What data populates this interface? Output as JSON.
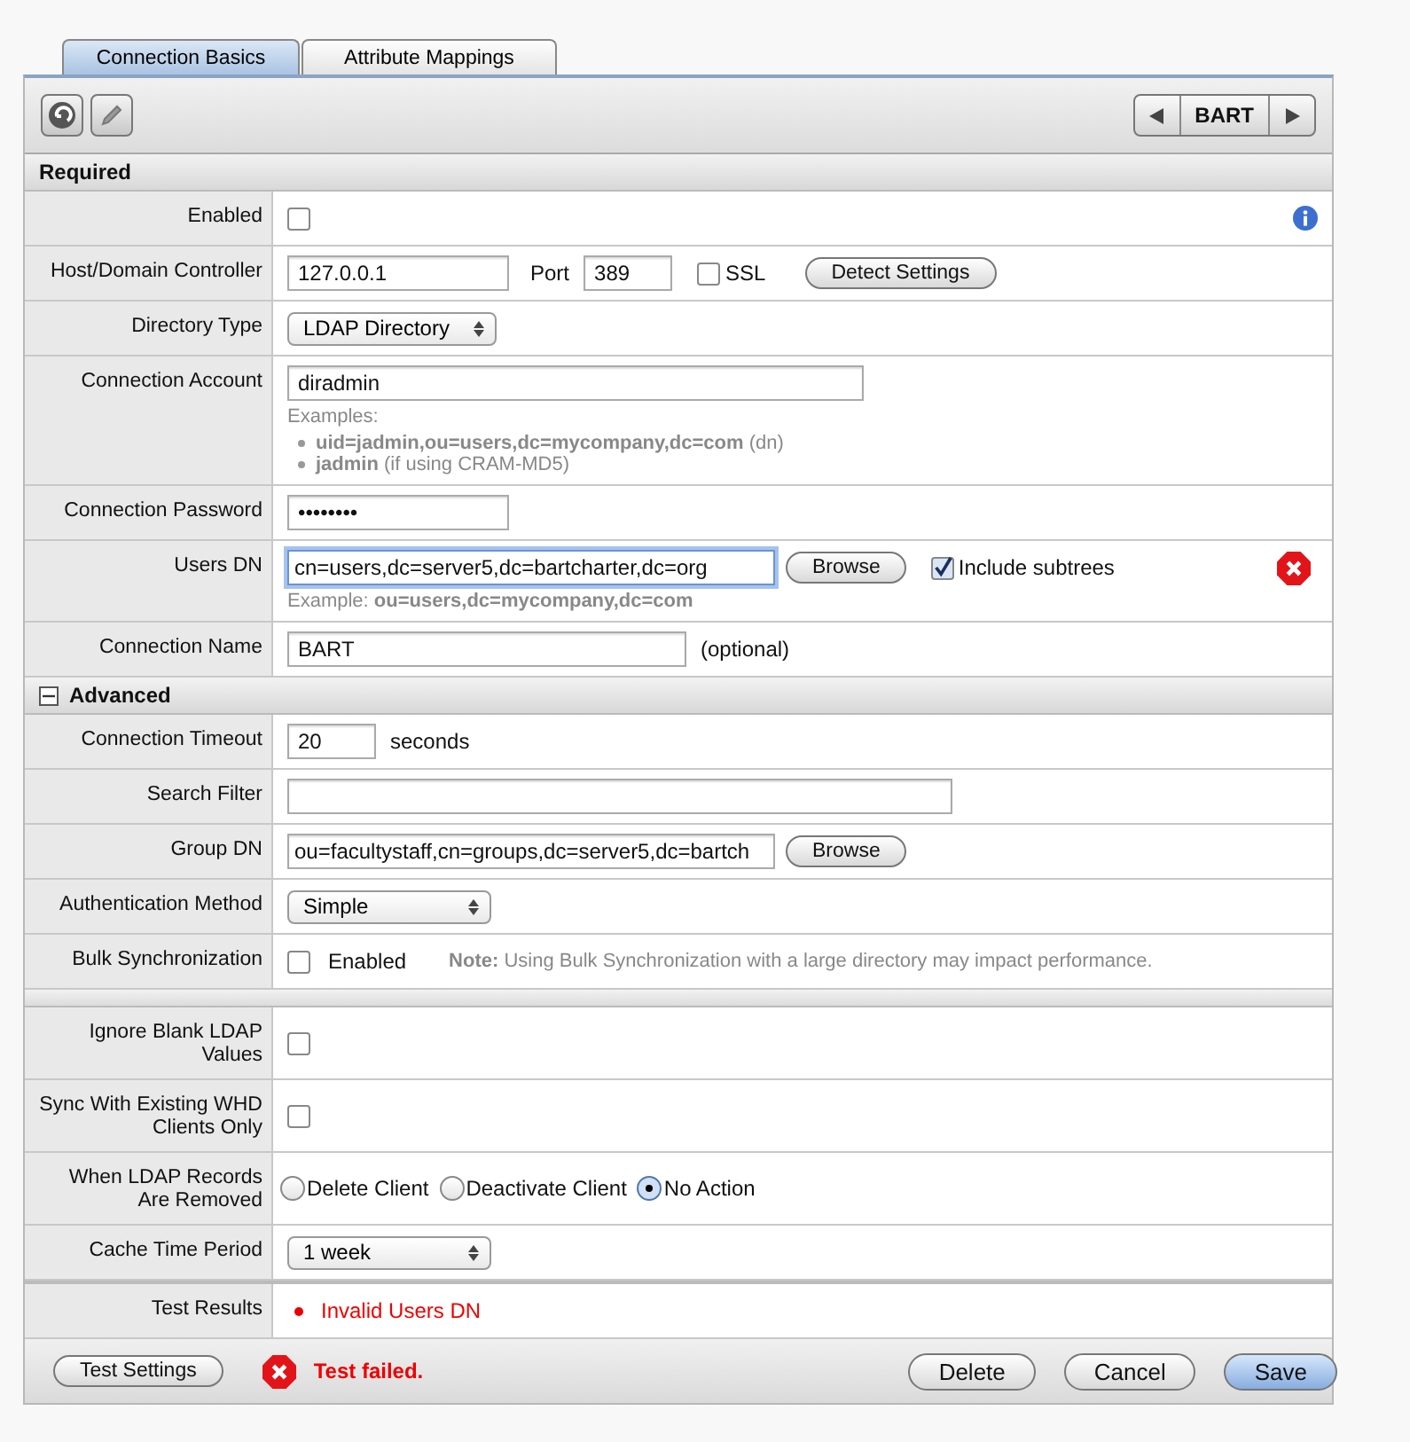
{
  "tabs": [
    {
      "label": "Connection Basics",
      "selected": true
    },
    {
      "label": "Attribute Mappings",
      "selected": false
    }
  ],
  "navigator": {
    "label": "BART"
  },
  "sections": [
    {
      "kind": "plain",
      "title": "Required",
      "rows": [
        {
          "kind": "checkbox",
          "label": "Enabled",
          "checked": false,
          "info": true
        },
        {
          "kind": "host",
          "label": "Host/Domain Controller",
          "value": "127.0.0.1",
          "port_label": "Port",
          "port": "389",
          "ssl_label": "SSL",
          "ssl": false,
          "button": "Detect Settings"
        },
        {
          "kind": "select",
          "label": "Directory Type",
          "value": "LDAP Directory"
        },
        {
          "kind": "examples",
          "label": "Connection Account",
          "value": "diradmin",
          "examples_title": "Examples:",
          "examples": [
            "**uid=jadmin,ou=users,dc=mycompany,dc=com** (dn)",
            "**jadmin** (if using CRAM-MD5)"
          ]
        },
        {
          "kind": "password",
          "label": "Connection Password",
          "value": "••••••••"
        },
        {
          "kind": "dn",
          "label": "Users DN",
          "value": "cn=users,dc=server5,dc=bartcharter,dc=org",
          "focused": true,
          "button": "Browse",
          "checkbox_label": "Include subtrees",
          "checked": true,
          "error": true,
          "hint": "Example: **ou=users,dc=mycompany,dc=com**"
        },
        {
          "kind": "name",
          "label": "Connection Name",
          "value": "BART",
          "suffix": "(optional)"
        }
      ]
    },
    {
      "kind": "toggle",
      "title": "Advanced",
      "expanded": true,
      "rows": [
        {
          "kind": "number",
          "label": "Connection Timeout",
          "value": "20",
          "suffix": "seconds"
        },
        {
          "kind": "filter",
          "label": "Search Filter"
        },
        {
          "kind": "dn",
          "label": "Group DN",
          "value": "ou=facultystaff,cn=groups,dc=server5,dc=bartch",
          "focused": false,
          "button": "Browse",
          "error": false
        },
        {
          "kind": "select",
          "label": "Authentication Method",
          "value": "Simple"
        },
        {
          "kind": "bulk",
          "label": "Bulk Synchronization",
          "checked": false,
          "checkbox_label": "Enabled",
          "note": "**Note:** Using Bulk Synchronization with a large directory may impact performance."
        }
      ]
    },
    {
      "kind": "bar",
      "rows": [
        {
          "kind": "checkbox",
          "label": "Ignore Blank LDAP Values",
          "checked": false,
          "info": false
        },
        {
          "kind": "checkbox",
          "label": "Sync With Existing WHD Clients Only",
          "checked": false,
          "info": false
        },
        {
          "kind": "radio",
          "label": "When LDAP Records Are Removed",
          "options": [
            {
              "label": "Delete Client",
              "selected": false
            },
            {
              "label": "Deactivate Client",
              "selected": false
            },
            {
              "label": "No Action",
              "selected": true
            }
          ]
        },
        {
          "kind": "select",
          "label": "Cache Time Period",
          "value": "1 week"
        }
      ]
    },
    {
      "kind": "rule",
      "rows": [
        {
          "kind": "results",
          "label": "Test Results",
          "items": [
            "Invalid Users DN"
          ]
        }
      ]
    }
  ],
  "footer": {
    "test_button": "Test Settings",
    "status": "Test failed.",
    "status_error": true,
    "buttons": [
      {
        "label": "Delete",
        "primary": false
      },
      {
        "label": "Cancel",
        "primary": false
      },
      {
        "label": "Save",
        "primary": true
      }
    ]
  }
}
